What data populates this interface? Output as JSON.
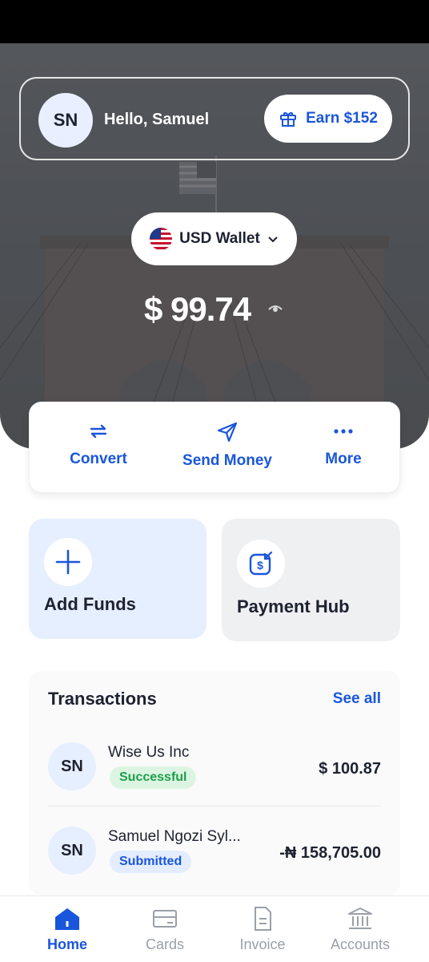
{
  "header": {
    "avatar_initials": "SN",
    "greeting": "Hello, Samuel",
    "earn_label": "Earn $152"
  },
  "wallet": {
    "selector_label": "USD Wallet",
    "balance": "$ 99.74"
  },
  "quick_actions": {
    "convert": "Convert",
    "send_money": "Send Money",
    "more": "More"
  },
  "tiles": {
    "add_funds": "Add Funds",
    "payment_hub": "Payment Hub"
  },
  "transactions": {
    "title": "Transactions",
    "see_all": "See all",
    "items": [
      {
        "initials": "SN",
        "name": "Wise Us Inc",
        "status": "Successful",
        "amount": "$ 100.87"
      },
      {
        "initials": "SN",
        "name": "Samuel Ngozi Syl...",
        "status": "Submitted",
        "amount": "-₦ 158,705.00"
      }
    ]
  },
  "bottom_nav": {
    "items": [
      {
        "label": "Home",
        "active": true
      },
      {
        "label": "Cards",
        "active": false
      },
      {
        "label": "Invoice",
        "active": false
      },
      {
        "label": "Accounts",
        "active": false
      }
    ]
  },
  "colors": {
    "accent": "#1a56db",
    "success": "#1e9e4a",
    "hero_overlay": "#4f5256"
  }
}
